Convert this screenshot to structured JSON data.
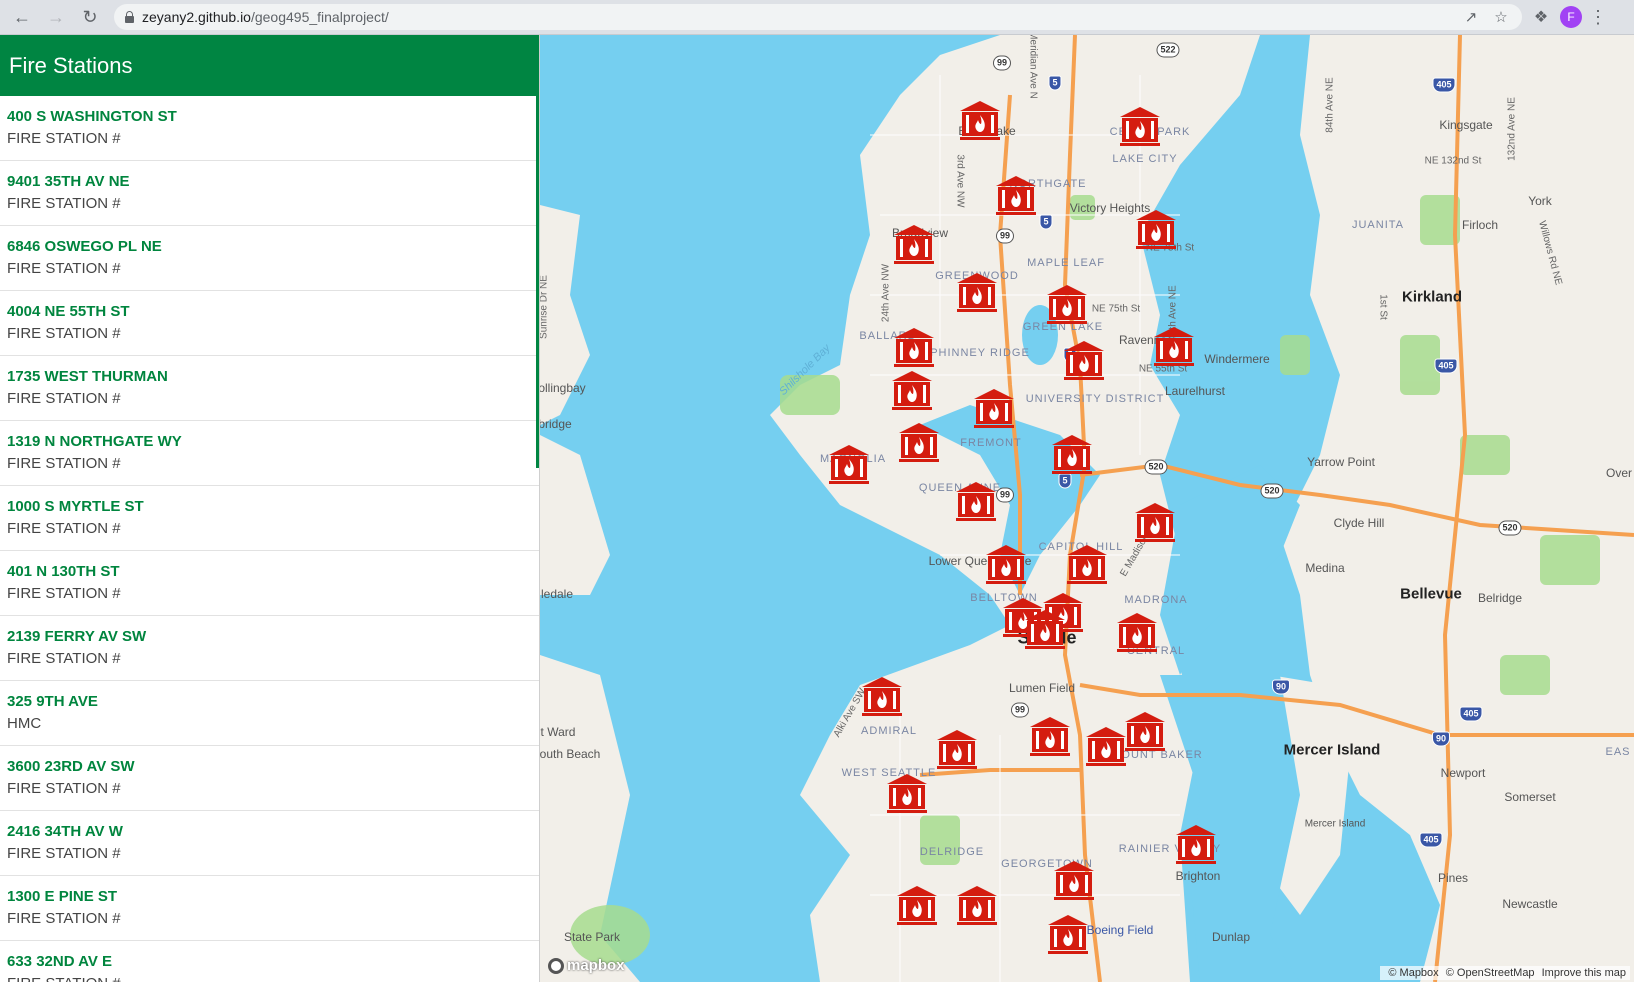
{
  "browser": {
    "url_host": "zeyany2.github.io",
    "url_path": "/geog495_finalproject/",
    "avatar_letter": "F"
  },
  "sidebar": {
    "title": "Fire Stations",
    "items": [
      {
        "address": "400 S WASHINGTON ST",
        "desc": "FIRE STATION #"
      },
      {
        "address": "9401 35TH AV NE",
        "desc": "FIRE STATION #"
      },
      {
        "address": "6846 OSWEGO PL NE",
        "desc": "FIRE STATION #"
      },
      {
        "address": "4004 NE 55TH ST",
        "desc": "FIRE STATION #"
      },
      {
        "address": "1735 WEST THURMAN",
        "desc": "FIRE STATION #"
      },
      {
        "address": "1319 N NORTHGATE WY",
        "desc": "FIRE STATION #"
      },
      {
        "address": "1000 S MYRTLE ST",
        "desc": "FIRE STATION #"
      },
      {
        "address": "401 N 130TH ST",
        "desc": "FIRE STATION #"
      },
      {
        "address": "2139 FERRY AV SW",
        "desc": "FIRE STATION #"
      },
      {
        "address": "325 9TH AVE",
        "desc": "HMC"
      },
      {
        "address": "3600 23RD AV SW",
        "desc": "FIRE STATION #"
      },
      {
        "address": "2416 34TH AV W",
        "desc": "FIRE STATION #"
      },
      {
        "address": "1300 E PINE ST",
        "desc": "FIRE STATION #"
      },
      {
        "address": "633 32ND AV E",
        "desc": "FIRE STATION #"
      }
    ]
  },
  "map": {
    "labels": {
      "bitter_lake": "Bitter Lake",
      "cedar_park": "CEDAR PARK",
      "lake_city": "LAKE CITY",
      "northgate": "NORTHGATE",
      "victory_heights": "Victory Heights",
      "broadview": "Broadview",
      "maple_leaf": "MAPLE LEAF",
      "greenwood": "GREENWOOD",
      "green_lake": "GREEN LAKE",
      "ballard": "BALLARD",
      "phinney_ridge": "PHINNEY RIDGE",
      "ravenna": "Ravenna",
      "windermere": "Windermere",
      "university_district": "UNIVERSITY DISTRICT",
      "laurelhurst": "Laurelhurst",
      "fremont": "FREMONT",
      "magnolia": "MAGNOLIA",
      "queen_anne": "QUEEN ANNE",
      "capitol_hill": "CAPITOL HILL",
      "lower_queen_anne": "Lower Queen Anne",
      "belltown": "BELLTOWN",
      "madrona": "MADRONA",
      "seattle": "Seattle",
      "central": "CENTRAL",
      "lumen_field": "Lumen Field",
      "admiral": "ADMIRAL",
      "west_seattle": "WEST SEATTLE",
      "mount_baker": "MOUNT BAKER",
      "delridge": "DELRIDGE",
      "georgetown": "GEORGETOWN",
      "rainier_valley": "RAINIER VALLEY",
      "brighton": "Brighton",
      "boeing_field": "Boeing Field",
      "dunlap": "Dunlap",
      "kingsgate": "Kingsgate",
      "juanita": "JUANITA",
      "firloch": "Firloch",
      "york": "York",
      "kirkland": "Kirkland",
      "yarrow_point": "Yarrow Point",
      "clyde_hill": "Clyde Hill",
      "medina": "Medina",
      "bellevue": "Bellevue",
      "belridge": "Belridge",
      "mercer_island": "Mercer Island",
      "mercer_island_small": "Mercer Island",
      "newport": "Newport",
      "somerset": "Somerset",
      "pines": "Pines",
      "newcastle": "Newcastle",
      "over": "Over",
      "shilshole_bay": "Shilshole Bay",
      "bollingbay": "ollingbay",
      "bridge": "bridge",
      "ledale": "ledale",
      "westward": "t Ward",
      "south_beach": "outh Beach",
      "state_park": "State Park",
      "eas": "EAS",
      "meridian": "Meridian Ave N",
      "third_ave": "3rd Ave NW",
      "twentyfourth": "24th Ave NW",
      "sunrise": "Sunrise Dr NE",
      "ne75": "NE 75th St",
      "ne55": "NE 55th St",
      "ne75b": "NE 75th St",
      "fortieth": "40th Ave NE",
      "e_madison": "E Madison St",
      "alki": "Alki Ave SW",
      "eightyfourth": "84th Ave NE",
      "onethirtysecond": "132nd Ave NE",
      "ne132": "NE 132nd St",
      "first_st": "1st St",
      "willows": "Willows Rd NE"
    },
    "shields": {
      "s522": "522",
      "s99a": "99",
      "s99b": "99",
      "s99c": "99",
      "s99d": "99",
      "i5a": "5",
      "i5b": "5",
      "i5c": "5",
      "i5d": "5",
      "s520a": "520",
      "s520b": "520",
      "s520c": "520",
      "i405a": "405",
      "i405b": "405",
      "i405c": "405",
      "i405d": "405",
      "i90a": "90",
      "i90b": "90"
    },
    "attribution": {
      "mapbox": "© Mapbox",
      "osm": "© OpenStreetMap",
      "improve": "Improve this map"
    },
    "logo_text": "mapbox",
    "marker_icon": "fire-station-icon",
    "marker_color": "#d41c0f",
    "water_color": "#75cff0",
    "land_color": "#f2efe9",
    "park_color": "#a7dc8e",
    "highway_color": "#f5a050"
  }
}
